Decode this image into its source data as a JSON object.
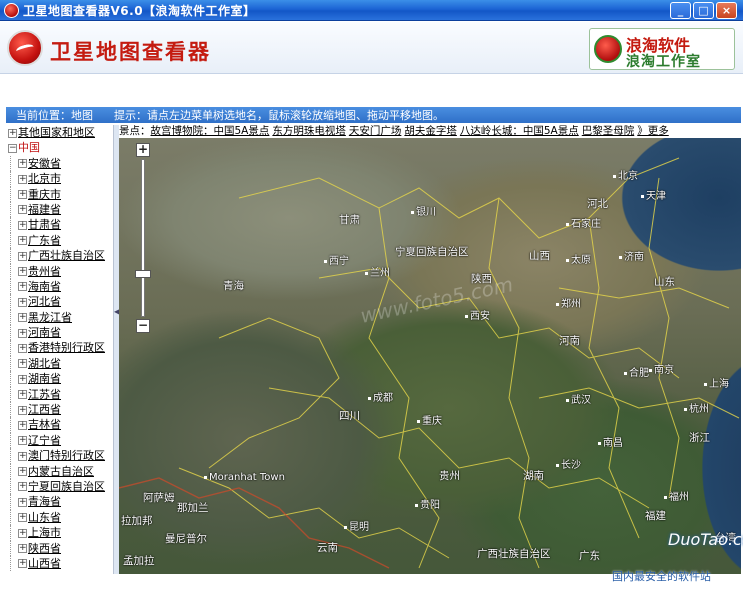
{
  "window": {
    "title": "卫星地图查看器V6.0【浪淘软件工作室】",
    "buttons": [
      "_",
      "□",
      "×"
    ]
  },
  "header": {
    "app_title": "卫星地图查看器",
    "brand_name": "浪淘软件",
    "brand_sub": "浪淘工作室"
  },
  "infobar": {
    "location": "当前位置：地图",
    "tip": "提示：请点左边菜单树选地名，鼠标滚轮放缩地图、拖动平移地图。"
  },
  "tree": {
    "root_other": "其他国家和地区",
    "root_china": "中国",
    "provinces": [
      "安徽省",
      "北京市",
      "重庆市",
      "福建省",
      "甘肃省",
      "广东省",
      "广西壮族自治区",
      "贵州省",
      "海南省",
      "河北省",
      "黑龙江省",
      "河南省",
      "香港特别行政区",
      "湖北省",
      "湖南省",
      "江苏省",
      "江西省",
      "吉林省",
      "辽宁省",
      "澳门特别行政区",
      "内蒙古自治区",
      "宁夏回族自治区",
      "青海省",
      "山东省",
      "上海市",
      "陕西省",
      "山西省"
    ]
  },
  "scenic": {
    "prefix": "景点：",
    "items": [
      "故宫博物院：中国5A景点",
      "东方明珠电视塔",
      "天安门广场",
      "胡夫金字塔",
      "八达岭长城：中国5A景点",
      "巴黎圣母院",
      "》更多"
    ]
  },
  "map": {
    "zoom_in": "+",
    "zoom_out": "−",
    "zoom_level": 0.73,
    "watermark": "www.foto5.com",
    "labels": [
      "甘肃",
      "银川",
      "北京",
      "天津",
      "河北",
      "西宁",
      "宁夏回族自治区",
      "石家庄",
      "青海",
      "兰州",
      "山西",
      "济南",
      "陕西",
      "太原",
      "山东",
      "郑州",
      "西安",
      "河南",
      "合肥",
      "南京",
      "上海",
      "成都",
      "武汉",
      "四川",
      "重庆",
      "杭州",
      "长沙",
      "南昌",
      "浙江",
      "贵阳",
      "湖南",
      "福州",
      "贵州",
      "福建",
      "昆明",
      "广西壮族自治区",
      "广东",
      "云南",
      "Moranhat Town",
      "阿萨姆",
      "那加兰",
      "拉加邦",
      "曼尼普尔",
      "孟加拉",
      "台湾"
    ]
  },
  "watermarks": {
    "duotao": "DuoTao.com",
    "bottom": "国内最安全的软件站"
  }
}
